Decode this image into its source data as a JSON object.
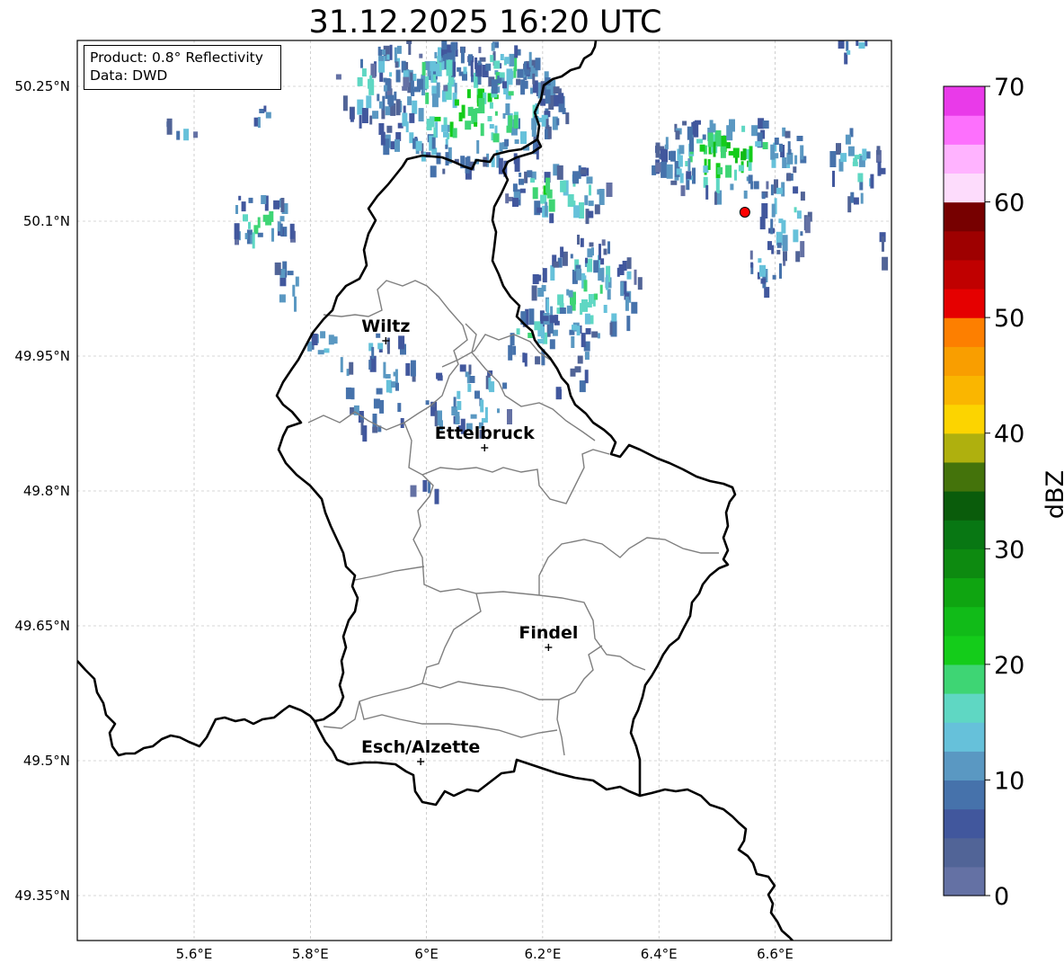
{
  "title": "31.12.2025 16:20 UTC",
  "info": {
    "product": "Product: 0.8° Reflectivity",
    "data": "Data: DWD"
  },
  "axes": {
    "lon_ticks": [
      "5.6°E",
      "5.8°E",
      "6°E",
      "6.2°E",
      "6.4°E",
      "6.6°E"
    ],
    "lat_ticks": [
      "50.25°N",
      "50.1°N",
      "49.95°N",
      "49.8°N",
      "49.65°N",
      "49.5°N",
      "49.35°N"
    ],
    "lon_values": [
      5.6,
      5.8,
      6.0,
      6.2,
      6.4,
      6.6
    ],
    "lat_values": [
      50.25,
      50.1,
      49.95,
      49.8,
      49.65,
      49.5,
      49.35
    ],
    "lon_range": [
      5.4,
      6.8
    ],
    "lat_range": [
      49.3,
      50.3
    ]
  },
  "cities": [
    {
      "name": "Wiltz",
      "lon": 5.93,
      "lat": 49.967
    },
    {
      "name": "Ettelbruck",
      "lon": 6.1,
      "lat": 49.848
    },
    {
      "name": "Findel",
      "lon": 6.21,
      "lat": 49.626
    },
    {
      "name": "Esch/Alzette",
      "lon": 5.99,
      "lat": 49.499
    }
  ],
  "radar_site": {
    "lon": 6.548,
    "lat": 50.11,
    "color": "#ff0000"
  },
  "colorbar": {
    "label": "dBZ",
    "min": 0,
    "max": 70,
    "step": 2.5,
    "tick_labels": [
      "0",
      "10",
      "20",
      "30",
      "40",
      "50",
      "60",
      "70"
    ],
    "colors": [
      "#6471a4",
      "#516497",
      "#41579d",
      "#4672ab",
      "#5a98c2",
      "#66c1da",
      "#5fd7c3",
      "#3ed574",
      "#14cc1a",
      "#11bb18",
      "#0fa511",
      "#0d8a10",
      "#087713",
      "#0a5c0b",
      "#44730b",
      "#afb00e",
      "#fcd400",
      "#fab600",
      "#f99e00",
      "#fd7f00",
      "#e50000",
      "#c00000",
      "#9e0000",
      "#770000",
      "#fddcfc",
      "#ffb3ff",
      "#fd70fd",
      "#e93ae9"
    ]
  },
  "style": {
    "border_color": "#000000",
    "canton_color": "#7f7f7f",
    "grid_color": "#b0b0b0"
  }
}
